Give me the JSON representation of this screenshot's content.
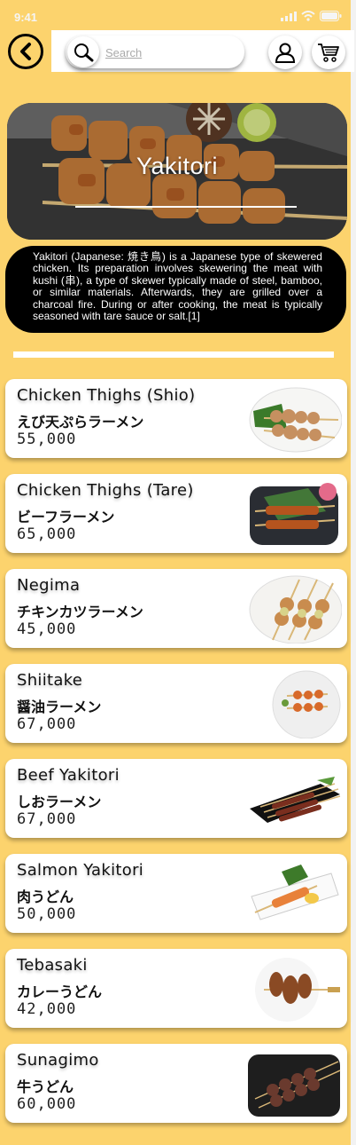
{
  "status_bar": {
    "time": "9:41"
  },
  "search": {
    "placeholder": "Search"
  },
  "hero": {
    "title": "Yakitori",
    "description": "Yakitori (Japanese: 焼き鳥) is a Japanese type of skewered chicken. Its preparation involves skewering the meat with kushi (串), a type of skewer typically made of steel, bamboo, or similar materials. Afterwards, they are grilled over a charcoal fire. During or after cooking, the meat is typically seasoned with tare sauce or salt.[1]"
  },
  "items": [
    {
      "name": "Chicken Thighs (Shio)",
      "jp": "えび天ぷらラーメン",
      "price": "55,000"
    },
    {
      "name": "Chicken Thighs (Tare)",
      "jp": "ビーフラーメン",
      "price": "65,000"
    },
    {
      "name": "Negima",
      "jp": "チキンカツラーメン",
      "price": "45,000"
    },
    {
      "name": "Shiitake",
      "jp": "醤油ラーメン",
      "price": "67,000"
    },
    {
      "name": "Beef Yakitori",
      "jp": "しおラーメン",
      "price": "67,000"
    },
    {
      "name": "Salmon Yakitori",
      "jp": "肉うどん",
      "price": "50,000"
    },
    {
      "name": "Tebasaki",
      "jp": "カレーうどん",
      "price": "42,000"
    },
    {
      "name": "Sunagimo",
      "jp": "牛うどん",
      "price": "60,000"
    }
  ],
  "colors": {
    "background": "#fcd36d",
    "card": "#ffffff",
    "description_bg": "#000000"
  }
}
